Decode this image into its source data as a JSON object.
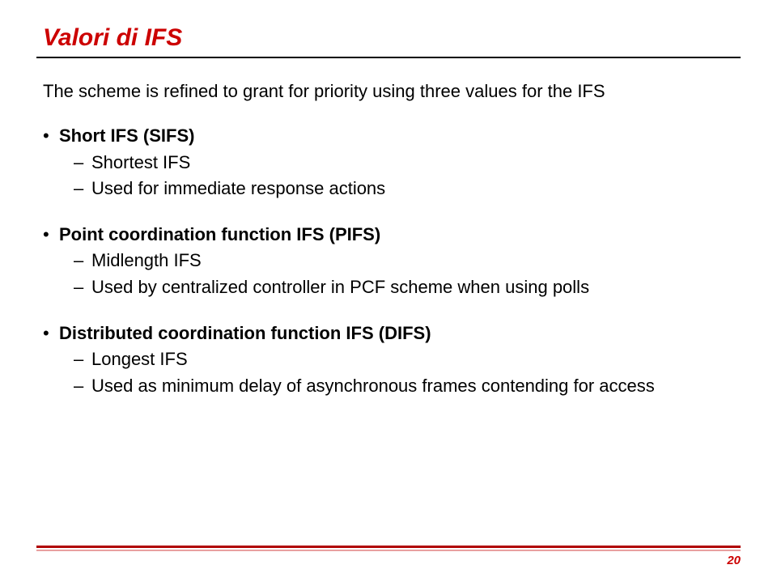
{
  "title": "Valori di IFS",
  "intro": "The scheme is refined to grant for priority using three values for the IFS",
  "items": [
    {
      "heading": "Short IFS (SIFS)",
      "sub": [
        "Shortest IFS",
        "Used for immediate response actions"
      ]
    },
    {
      "heading": "Point coordination function IFS (PIFS)",
      "sub": [
        "Midlength IFS",
        "Used by centralized controller in PCF scheme when using polls"
      ]
    },
    {
      "heading": "Distributed coordination function IFS (DIFS)",
      "sub": [
        "Longest IFS",
        "Used as minimum delay of asynchronous frames contending for access"
      ]
    }
  ],
  "page_number": "20"
}
